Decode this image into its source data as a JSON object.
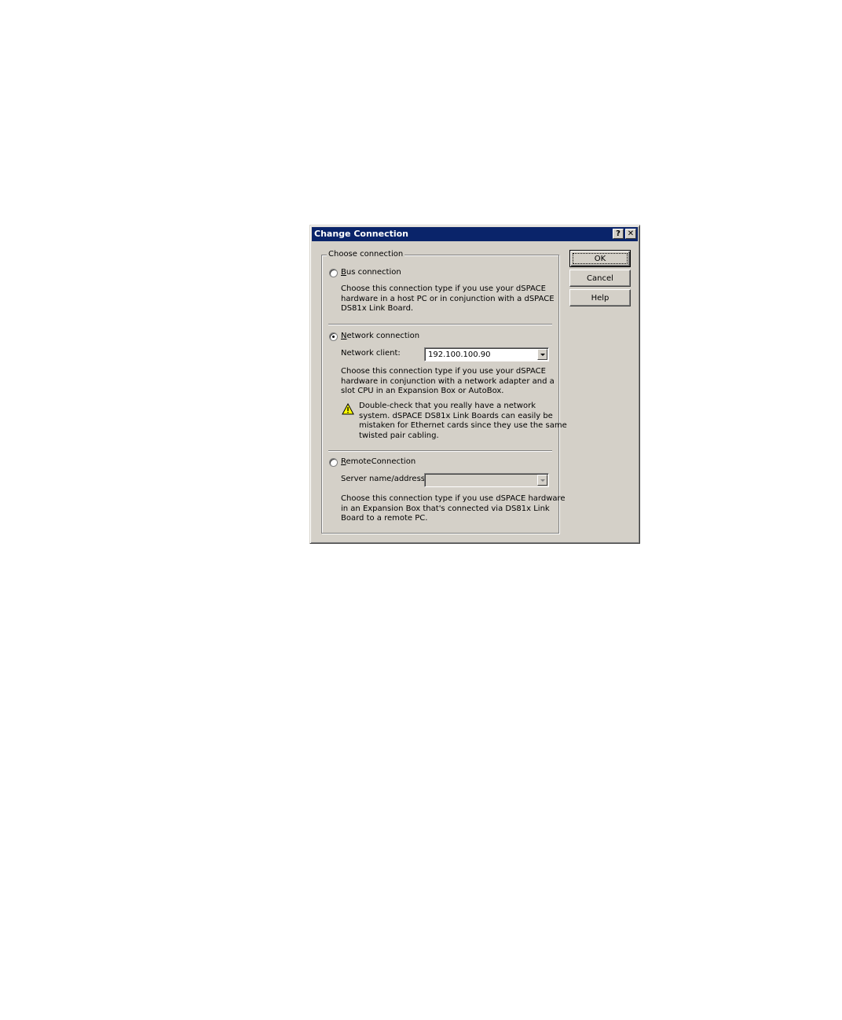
{
  "dialog": {
    "title": "Change Connection",
    "help_glyph": "?",
    "close_glyph": "✕"
  },
  "group": {
    "legend": "Choose connection"
  },
  "bus": {
    "label_underlined": "B",
    "label_rest": "us connection",
    "selected": false,
    "description": [
      "Choose this connection type if you use your dSPACE",
      "hardware in a host PC or in conjunction with a dSPACE",
      "DS81x Link Board."
    ]
  },
  "network": {
    "label_underlined": "N",
    "label_rest": "etwork connection",
    "selected": true,
    "client_label": "Network client:",
    "client_value": "192.100.100.90",
    "description": [
      "Choose this connection type if you use your dSPACE",
      "hardware in conjunction with a network adapter and a",
      "slot CPU in an Expansion Box or AutoBox."
    ],
    "warning_icon": "warning-triangle-icon",
    "warning": [
      "Double-check that you really have a network",
      "system. dSPACE DS81x Link Boards can easily be",
      "mistaken for Ethernet cards since they use the same",
      "twisted pair cabling."
    ]
  },
  "remote": {
    "label_underlined": "R",
    "label_rest": "emoteConnection",
    "selected": false,
    "server_label": "Server name/address:",
    "server_value": "",
    "description": [
      "Choose this connection type if you use dSPACE hardware",
      "in an Expansion Box that's connected via DS81x Link",
      "Board to a remote PC."
    ]
  },
  "buttons": {
    "ok": "OK",
    "cancel": "Cancel",
    "help": "Help"
  },
  "colors": {
    "titlebar": "#0a246a",
    "face": "#d4d0c8"
  }
}
